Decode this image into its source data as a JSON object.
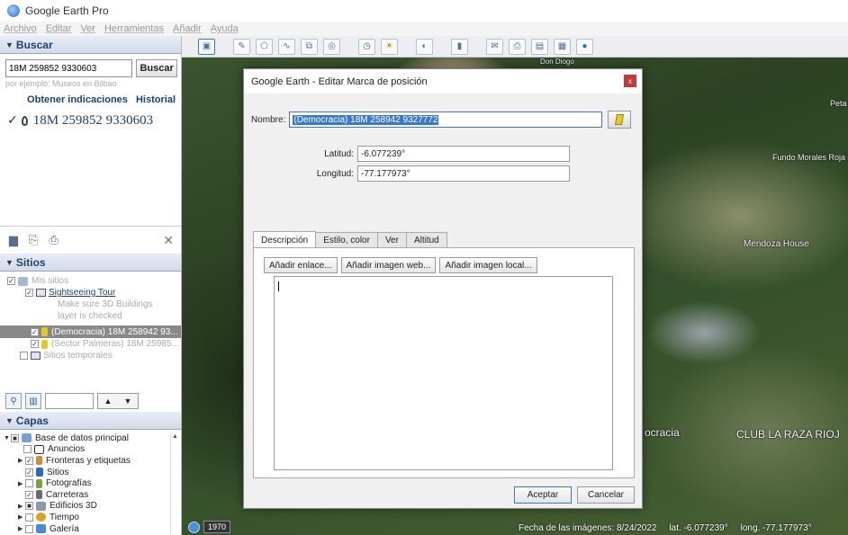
{
  "app": {
    "title": "Google Earth Pro"
  },
  "menu": [
    "Archivo",
    "Editar",
    "Ver",
    "Herramientas",
    "Añadir",
    "Ayuda"
  ],
  "search": {
    "header": "Buscar",
    "value": "18M 259852 9330603",
    "button": "Buscar",
    "example": "por ejemplo: Museos en Bilbao",
    "directions": "Obtener indicaciones",
    "history": "Historial",
    "result": "18M 259852 9330603"
  },
  "places": {
    "header": "Sitios",
    "items": [
      "Mis sitios",
      "Sightseeing Tour",
      "Make sure 3D Buildings",
      "layer is checked",
      "(Democracia) 18M 258942 93...",
      "(Sector Palmeras) 18M 25985...",
      "Sitios temporales"
    ]
  },
  "layers": {
    "header": "Capas",
    "items": [
      "Base de datos principal",
      "Anuncios",
      "Fronteras y etiquetas",
      "Sitios",
      "Fotografías",
      "Carreteras",
      "Edificios 3D",
      "Tiempo",
      "Galería"
    ]
  },
  "map": {
    "labels": [
      "Don Diogo",
      "Peta",
      "Fundo Morales Roja",
      "Mendoza House",
      "ocracia",
      "CLUB LA RAZA RIOJ"
    ],
    "year": "1970",
    "status_date": "Fecha de las imágenes: 8/24/2022",
    "status_lat": "lat.  -6.077239°",
    "status_long": "long.  -77.177973°"
  },
  "dialog": {
    "title": "Google Earth - Editar Marca de posición",
    "close": "x",
    "name_label": "Nombre:",
    "name_value": "(Democracia) 18M 258942 9327772",
    "lat_label": "Latitud:",
    "lat_value": "-6.077239°",
    "long_label": "Longitud:",
    "long_value": "-77.177973°",
    "tabs": [
      "Descripción",
      "Estilo, color",
      "Ver",
      "Altitud"
    ],
    "desc_buttons": [
      "Añadir enlace...",
      "Añadir imagen web...",
      "Añadir imagen local..."
    ],
    "ok": "Aceptar",
    "cancel": "Cancelar"
  }
}
